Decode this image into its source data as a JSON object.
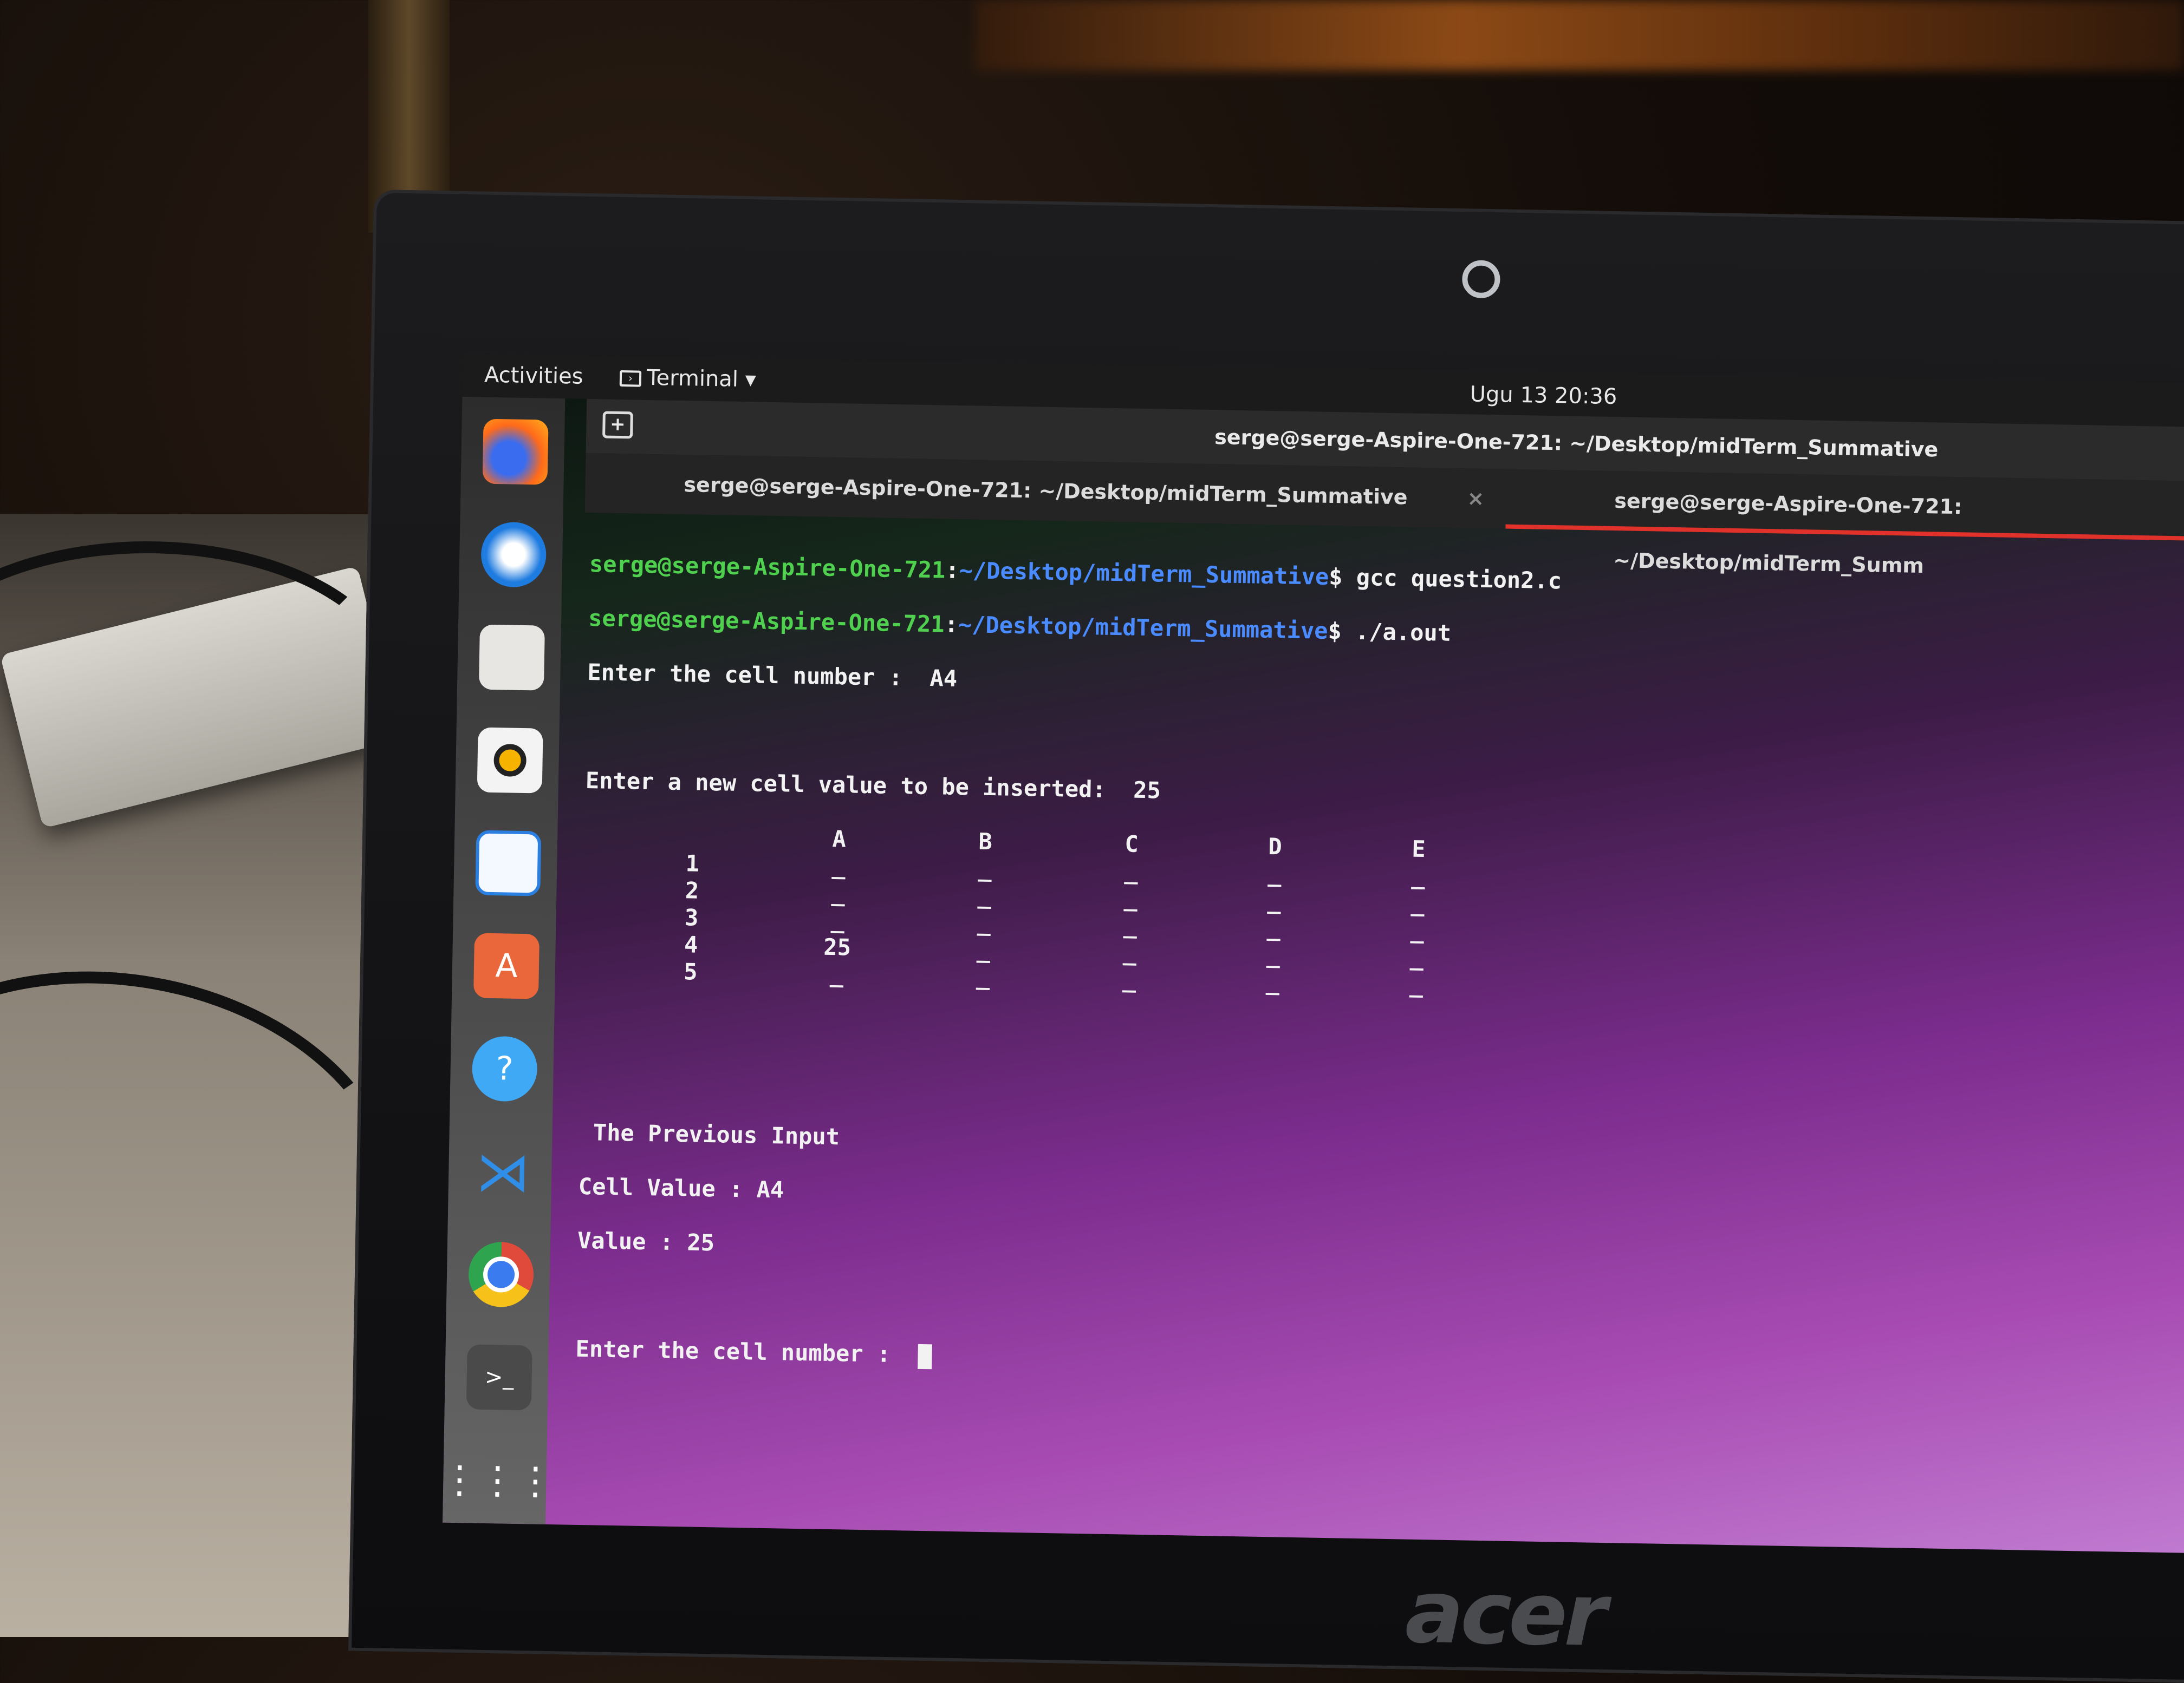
{
  "topbar": {
    "activities": "Activities",
    "app_menu": "Terminal",
    "clock": "Ugu 13  20:36"
  },
  "window": {
    "title": "serge@serge-Aspire-One-721: ~/Desktop/midTerm_Summative",
    "tabs": [
      {
        "label": "serge@serge-Aspire-One-721: ~/Desktop/midTerm_Summative"
      },
      {
        "label": "serge@serge-Aspire-One-721: ~/Desktop/midTerm_Summ"
      }
    ]
  },
  "console": {
    "prompt_user": "serge@serge-Aspire-One-721",
    "prompt_path": "~/Desktop/midTerm_Summative",
    "cmd1": "$ gcc question2.c",
    "cmd2": "$ ./a.out",
    "enter_cell": "Enter the cell number :  A4",
    "enter_value": "Enter a new cell value to be inserted:  25",
    "columns": [
      "A",
      "B",
      "C",
      "D",
      "E"
    ],
    "rows": [
      {
        "num": "1",
        "cells": [
          "_",
          "_",
          "_",
          "_",
          "_"
        ]
      },
      {
        "num": "2",
        "cells": [
          "_",
          "_",
          "_",
          "_",
          "_"
        ]
      },
      {
        "num": "3",
        "cells": [
          "_",
          "_",
          "_",
          "_",
          "_"
        ]
      },
      {
        "num": "4",
        "cells": [
          "25",
          "_",
          "_",
          "_",
          "_"
        ]
      },
      {
        "num": "5",
        "cells": [
          "_",
          "_",
          "_",
          "_",
          "_"
        ]
      }
    ],
    "previous_header": " The Previous Input",
    "previous_cell": "Cell Value : A4",
    "previous_value": "Value : 25",
    "enter_again": "Enter the cell number :  "
  },
  "dock": [
    {
      "icon": "firefox-icon"
    },
    {
      "icon": "thunderbird-icon"
    },
    {
      "icon": "files-icon"
    },
    {
      "icon": "rhythmbox-icon"
    },
    {
      "icon": "writer-icon"
    },
    {
      "icon": "software-icon"
    },
    {
      "icon": "help-icon"
    },
    {
      "icon": "vscode-icon"
    },
    {
      "icon": "chrome-icon"
    },
    {
      "icon": "terminal-icon"
    },
    {
      "icon": "app-grid-icon"
    }
  ],
  "laptop_brand": "acer"
}
